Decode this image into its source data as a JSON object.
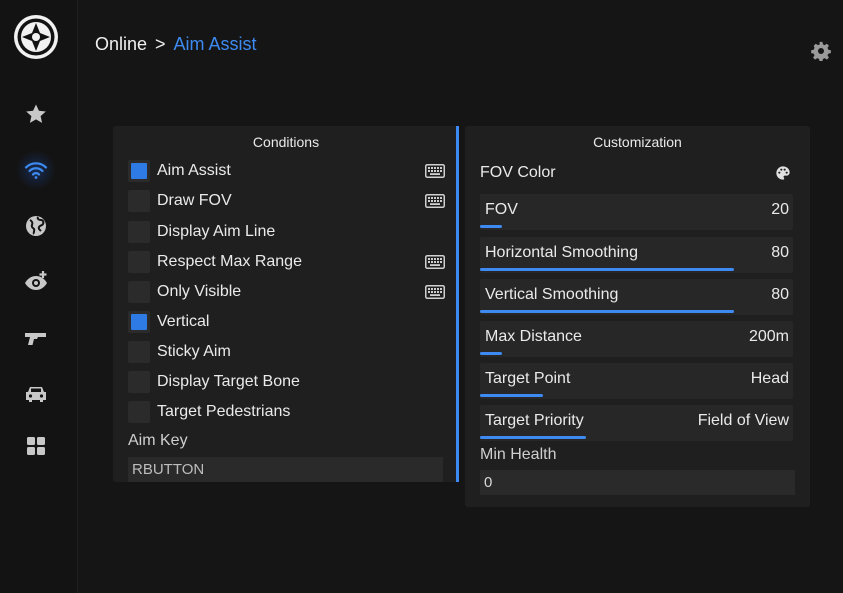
{
  "breadcrumb": {
    "parent": "Online",
    "separator": ">",
    "current": "Aim Assist"
  },
  "sidebar": {
    "items": [
      {
        "icon": "star-icon",
        "active": false
      },
      {
        "icon": "wifi-icon",
        "active": true
      },
      {
        "icon": "globe-icon",
        "active": false
      },
      {
        "icon": "eye-plus-icon",
        "active": false
      },
      {
        "icon": "gun-icon",
        "active": false
      },
      {
        "icon": "car-icon",
        "active": false
      },
      {
        "icon": "grid-icon",
        "active": false
      }
    ]
  },
  "conditions": {
    "title": "Conditions",
    "items": [
      {
        "label": "Aim Assist",
        "checked": true,
        "hotkey": true
      },
      {
        "label": "Draw FOV",
        "checked": false,
        "hotkey": true
      },
      {
        "label": "Display Aim Line",
        "checked": false,
        "hotkey": false
      },
      {
        "label": "Respect Max Range",
        "checked": false,
        "hotkey": true
      },
      {
        "label": "Only Visible",
        "checked": false,
        "hotkey": true
      },
      {
        "label": "Vertical",
        "checked": true,
        "hotkey": false
      },
      {
        "label": "Sticky Aim",
        "checked": false,
        "hotkey": false
      },
      {
        "label": "Display Target Bone",
        "checked": false,
        "hotkey": false
      },
      {
        "label": "Target Pedestrians",
        "checked": false,
        "hotkey": false
      }
    ],
    "aim_key_label": "Aim Key",
    "aim_key_value": "RBUTTON"
  },
  "customization": {
    "title": "Customization",
    "fov_color_label": "FOV Color",
    "sliders": [
      {
        "label": "FOV",
        "value": "20",
        "fill": 0.07
      },
      {
        "label": "Horizontal Smoothing",
        "value": "80",
        "fill": 0.81
      },
      {
        "label": "Vertical Smoothing",
        "value": "80",
        "fill": 0.81
      },
      {
        "label": "Max Distance",
        "value": "200m",
        "fill": 0.07
      },
      {
        "label": "Target Point",
        "value": "Head",
        "fill": 0.2
      },
      {
        "label": "Target Priority",
        "value": "Field of View",
        "fill": 0.34
      }
    ],
    "min_health_label": "Min Health",
    "min_health_value": "0"
  },
  "colors": {
    "accent": "#3d8bf2",
    "checkbox_on": "#2f7be6",
    "panel": "#1f1f1f",
    "background": "#151515"
  }
}
